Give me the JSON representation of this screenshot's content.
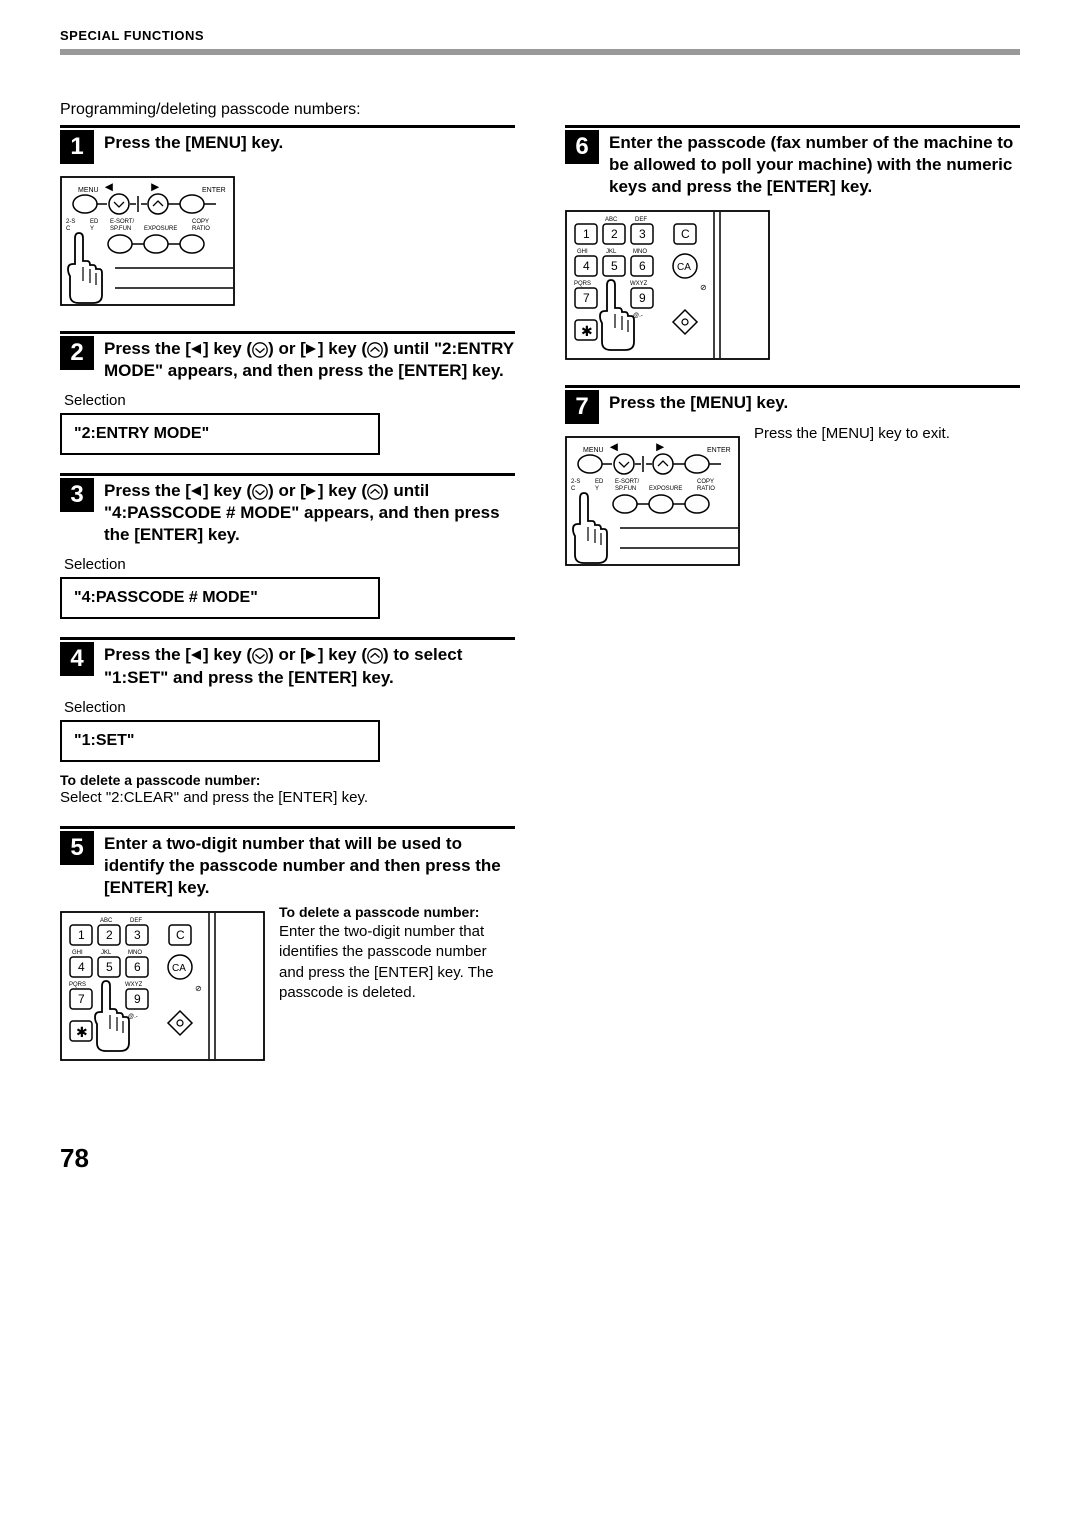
{
  "header": "SPECIAL FUNCTIONS",
  "intro": "Programming/deleting passcode numbers:",
  "page_number": "78",
  "steps": {
    "s1": {
      "n": "1",
      "text": "Press the [MENU] key."
    },
    "s2": {
      "n": "2",
      "prefix": "Press the [",
      "mid1": "] key (",
      "mid2": ") or [",
      "mid3": "] key (",
      "suffix": ") until \"2:ENTRY MODE\" appears, and then press the [ENTER] key."
    },
    "s3": {
      "n": "3",
      "prefix": "Press the [",
      "mid1": "] key (",
      "mid2": ") or [",
      "mid3": "] key (",
      "suffix": ") until \"4:PASSCODE # MODE\" appears, and then press the [ENTER] key."
    },
    "s4": {
      "n": "4",
      "prefix": "Press the [",
      "mid1": "] key (",
      "mid2": ") or [",
      "mid3": "] key (",
      "suffix": ") to select \"1:SET\" and press the [ENTER] key."
    },
    "s5": {
      "n": "5",
      "text": "Enter a two-digit number that will be used to identify the passcode number and then press the [ENTER] key."
    },
    "s6": {
      "n": "6",
      "text": "Enter the passcode (fax number of the machine to be allowed to poll your machine) with the numeric keys and press the [ENTER] key."
    },
    "s7": {
      "n": "7",
      "text": "Press the [MENU] key."
    }
  },
  "labels": {
    "selection": "Selection",
    "sel_entry": "\"2:ENTRY MODE\"",
    "sel_passcode": "\"4:PASSCODE # MODE\"",
    "sel_set": "\"1:SET\""
  },
  "notes": {
    "del_title": "To delete a passcode number:",
    "del_body1": "Select \"2:CLEAR\" and press the [ENTER] key.",
    "del_body2": "Enter the two-digit number that identifies the passcode number and press the [ENTER] key. The passcode is deleted.",
    "exit": "Press the [MENU] key to exit."
  },
  "panel_labels": {
    "menu": "MENU",
    "enter": "ENTER",
    "l2_1a": "2-S",
    "l2_1b": "C",
    "l2_2a": "ED",
    "l2_2b": "Y",
    "l2_3a": "E-SORT/",
    "l2_3b": "SP.FUN",
    "l2_4": "EXPOSURE",
    "l2_5a": "COPY",
    "l2_5b": "RATIO"
  },
  "keypad_labels": {
    "abc": "ABC",
    "def": "DEF",
    "ghi": "GHI",
    "jkl": "JKL",
    "mno": "MNO",
    "pqrs": "PQRS",
    "wxyz": "WXYZ",
    "at": "@.-",
    "k1": "1",
    "k2": "2",
    "k3": "3",
    "k4": "4",
    "k5": "5",
    "k6": "6",
    "k7": "7",
    "k9": "9",
    "c": "C",
    "ca": "CA"
  }
}
